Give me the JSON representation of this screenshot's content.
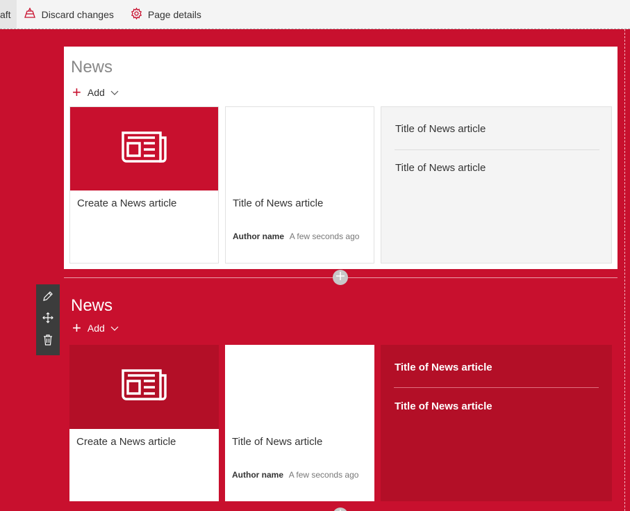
{
  "toolbar": {
    "draft_label": "aft",
    "discard_label": "Discard changes",
    "page_details_label": "Page details"
  },
  "section1": {
    "title": "News",
    "add_label": "Add",
    "create_card_title": "Create a News article",
    "article_card": {
      "title": "Title of News article",
      "author": "Author name",
      "time": "A few seconds ago"
    },
    "list_items": [
      "Title of News article",
      "Title of News article"
    ]
  },
  "section2": {
    "title": "News",
    "add_label": "Add",
    "create_card_title": "Create a News article",
    "article_card": {
      "title": "Title of News article",
      "author": "Author name",
      "time": "A few seconds ago"
    },
    "list_items": [
      "Title of News article",
      "Title of News article"
    ]
  },
  "colors": {
    "accent": "#c8102e",
    "accent_dark": "#b30f27",
    "list_panel_light": "#f4f4f4",
    "toolbar_bg": "#f4f4f4"
  },
  "icons": [
    "broom-icon",
    "gear-icon",
    "plus-icon",
    "chevron-down-icon",
    "newspaper-icon",
    "pencil-icon",
    "move-icon",
    "trash-icon"
  ]
}
